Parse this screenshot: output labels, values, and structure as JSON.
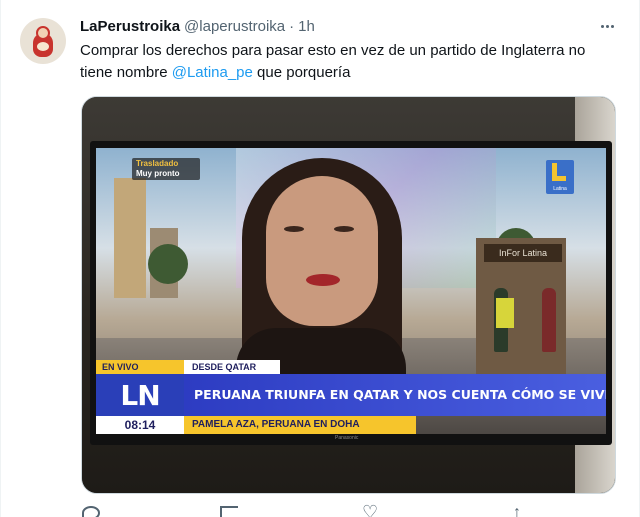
{
  "tweet": {
    "display_name": "LaPerustroika",
    "handle": "@laperustroika",
    "separator": "·",
    "time": "1h",
    "text_before": "Comprar los derechos para pasar esto en vez de un partido de Inglaterra no tiene nombre ",
    "mention": "@Latina_pe",
    "text_after": " que porquería",
    "avatar_icon": "matryoshka-doll-icon",
    "more_icon": "more-horizontal-icon"
  },
  "media": {
    "top_tag_line1": "Trasladado",
    "top_tag_line2": "Muy pronto",
    "channel_logo_label": "Latina",
    "live_label": "EN VIVO",
    "location_label": "DESDE QATAR",
    "network_logo": "LN",
    "headline": "PERUANA TRIUNFA EN QATAR Y NOS CUENTA CÓMO SE VIVE EL MUNDIAL",
    "clock": "08:14",
    "subline": "PAMELA AZA, PERUANA EN DOHA",
    "building_sign": "InFor  Latina",
    "tv_brand": "Panasonic"
  },
  "actions": {
    "reply_icon": "reply-icon",
    "retweet_icon": "retweet-icon",
    "like_icon": "heart-icon",
    "share_icon": "share-icon"
  },
  "colors": {
    "accent": "#1d9bf0",
    "text": "#0f1419",
    "muted": "#536471",
    "ln_blue": "#2a3fb8",
    "ln_yellow": "#f6c52c"
  }
}
